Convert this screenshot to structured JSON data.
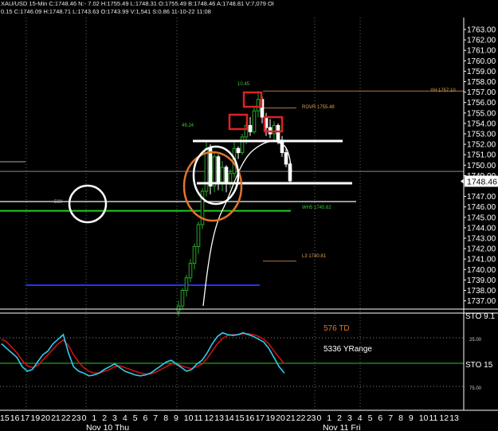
{
  "header": {
    "line1": "XAU/USD 15-Min C:1748.46 N:- 7.02 H:1755.49 L:1748.31 O:1755.49 B:1748.46 A:1748.81 V:7,079 OI",
    "line2": "0.15 C:1746.09 H:1748.71 L:1743.63 O:1743.99 V:1,541 S:0.86 11-10-22 11:08"
  },
  "colors": {
    "background": "#000000",
    "up_candle": "#22aa22",
    "down_candle": "#ffffff",
    "support_green": "#22cc22",
    "level_blue": "#2233ff",
    "marker_red": "#dd2222",
    "circle_orange": "#e2752a",
    "stoch_blue": "#33ccee",
    "stoch_red": "#cc1111",
    "axis_panel": "#ffffff"
  },
  "price_panel": {
    "current_price_label": "1748.46",
    "annotations": {
      "high_value": "10.45",
      "left_value": "49.24",
      "yh": "YH 1757.10",
      "rovr": "ROVR 1755.48",
      "wh5": "WH5 1745.62",
      "l3": "L3 1740.81",
      "round": "500"
    }
  },
  "stoch_panel": {
    "labels": {
      "td": "576 TD",
      "yrange": "5336 YRange",
      "sto_top": "STO 9.1",
      "sto_mid": "STO 15",
      "level_25": "25.00",
      "level_75": "75.00"
    }
  },
  "x_axis": {
    "day1": "Nov 10 Thu",
    "day2": "Nov 11 Fri"
  },
  "chart_data": {
    "type": "candlestick",
    "title": "",
    "symbol": "XAU/USD",
    "interval": "15-Min",
    "y_ticks": [
      1763,
      1762,
      1761,
      1760,
      1759,
      1758,
      1757,
      1756,
      1755,
      1754,
      1753,
      1752,
      1751,
      1750,
      1749,
      1747,
      1746,
      1745,
      1744,
      1743,
      1742,
      1741,
      1740,
      1739,
      1738,
      1737
    ],
    "y_tick_labels": [
      "1763.00",
      "1762.00",
      "1761.00",
      "1760.00",
      "1759.00",
      "1758.00",
      "1757.00",
      "1756.00",
      "1755.00",
      "1754.00",
      "1753.00",
      "1752.00",
      "1751.00",
      "1750.00",
      "1749.00",
      "1747.00",
      "1746.00",
      "1745.00",
      "1744.00",
      "1743.00",
      "1742.00",
      "1741.00",
      "1740.00",
      "1739.00",
      "1738.00",
      "1737.00"
    ],
    "ylim": [
      1736,
      1764
    ],
    "x_ticks": [
      "15",
      "16",
      "17",
      "19",
      "20",
      "21",
      "22",
      "23",
      "0",
      "1",
      "2",
      "3",
      "4",
      "5",
      "6",
      "7",
      "8",
      "9",
      "10",
      "11",
      "12",
      "13",
      "14",
      "15",
      "16",
      "17",
      "19",
      "20",
      "21",
      "22",
      "23",
      "0",
      "1",
      "2",
      "3",
      "4",
      "5",
      "6",
      "7",
      "8",
      "9",
      "10",
      "11",
      "12",
      "13"
    ],
    "price_levels": [
      {
        "label": "YH 1757.10",
        "value": 1757.1
      },
      {
        "label": "ROVR 1755.48",
        "value": 1755.48
      },
      {
        "label": "WH5 1745.62",
        "value": 1745.62
      },
      {
        "label": "L3 1740.81",
        "value": 1740.81
      }
    ],
    "blue_level": 1738.5,
    "current_price": 1748.46,
    "candles": [
      {
        "o": 1736.0,
        "h": 1737.0,
        "l": 1735.5,
        "c": 1736.5
      },
      {
        "o": 1736.5,
        "h": 1738.2,
        "l": 1736.2,
        "c": 1738.0
      },
      {
        "o": 1738.0,
        "h": 1739.5,
        "l": 1737.4,
        "c": 1739.2
      },
      {
        "o": 1739.2,
        "h": 1741.0,
        "l": 1738.8,
        "c": 1740.6
      },
      {
        "o": 1740.6,
        "h": 1742.5,
        "l": 1740.0,
        "c": 1742.2
      },
      {
        "o": 1742.2,
        "h": 1744.6,
        "l": 1741.5,
        "c": 1744.3
      },
      {
        "o": 1744.3,
        "h": 1747.8,
        "l": 1743.9,
        "c": 1747.5
      },
      {
        "o": 1747.5,
        "h": 1752.2,
        "l": 1747.0,
        "c": 1751.6
      },
      {
        "o": 1751.6,
        "h": 1752.0,
        "l": 1747.2,
        "c": 1748.0
      },
      {
        "o": 1748.0,
        "h": 1751.2,
        "l": 1747.4,
        "c": 1750.8
      },
      {
        "o": 1750.8,
        "h": 1751.0,
        "l": 1747.6,
        "c": 1748.4
      },
      {
        "o": 1748.4,
        "h": 1750.4,
        "l": 1747.5,
        "c": 1749.8
      },
      {
        "o": 1749.8,
        "h": 1750.0,
        "l": 1747.4,
        "c": 1748.2
      },
      {
        "o": 1748.2,
        "h": 1749.6,
        "l": 1747.8,
        "c": 1749.2
      },
      {
        "o": 1749.2,
        "h": 1752.2,
        "l": 1748.8,
        "c": 1751.6
      },
      {
        "o": 1751.6,
        "h": 1751.8,
        "l": 1750.6,
        "c": 1751.2
      },
      {
        "o": 1751.2,
        "h": 1753.0,
        "l": 1751.0,
        "c": 1752.7
      },
      {
        "o": 1752.7,
        "h": 1754.2,
        "l": 1752.0,
        "c": 1753.8
      },
      {
        "o": 1753.8,
        "h": 1754.6,
        "l": 1752.8,
        "c": 1753.2
      },
      {
        "o": 1753.2,
        "h": 1755.6,
        "l": 1753.0,
        "c": 1755.2
      },
      {
        "o": 1755.2,
        "h": 1757.1,
        "l": 1754.6,
        "c": 1756.3
      },
      {
        "o": 1756.3,
        "h": 1756.6,
        "l": 1754.0,
        "c": 1754.6
      },
      {
        "o": 1754.6,
        "h": 1755.0,
        "l": 1752.8,
        "c": 1753.6
      },
      {
        "o": 1753.6,
        "h": 1754.4,
        "l": 1752.6,
        "c": 1753.0
      },
      {
        "o": 1753.0,
        "h": 1754.2,
        "l": 1752.2,
        "c": 1753.8
      },
      {
        "o": 1753.8,
        "h": 1754.0,
        "l": 1752.0,
        "c": 1752.4
      },
      {
        "o": 1752.4,
        "h": 1752.8,
        "l": 1750.8,
        "c": 1751.2
      },
      {
        "o": 1751.2,
        "h": 1751.6,
        "l": 1749.8,
        "c": 1750.1
      },
      {
        "o": 1750.1,
        "h": 1750.4,
        "l": 1748.3,
        "c": 1748.5
      }
    ],
    "stochastic": {
      "ylim": [
        0,
        100
      ],
      "levels": [
        25,
        75
      ],
      "blue": [
        70,
        65,
        60,
        55,
        45,
        40,
        42,
        50,
        58,
        62,
        70,
        75,
        80,
        60,
        45,
        40,
        38,
        35,
        36,
        38,
        42,
        45,
        48,
        44,
        40,
        38,
        36,
        35,
        36,
        38,
        42,
        46,
        50,
        52,
        48,
        44,
        40,
        42,
        48,
        52,
        60,
        70,
        78,
        82,
        80,
        79,
        80,
        82,
        80,
        78,
        75,
        72,
        65,
        55,
        45,
        38
      ],
      "red": [
        75,
        72,
        66,
        60,
        52,
        46,
        44,
        46,
        52,
        58,
        64,
        70,
        74,
        68,
        58,
        50,
        44,
        40,
        38,
        38,
        40,
        42,
        45,
        46,
        44,
        42,
        40,
        38,
        37,
        37,
        39,
        42,
        45,
        48,
        48,
        46,
        44,
        43,
        45,
        48,
        54,
        62,
        70,
        76,
        79,
        80,
        80,
        81,
        81,
        80,
        78,
        75,
        70,
        62,
        55,
        48
      ]
    }
  }
}
